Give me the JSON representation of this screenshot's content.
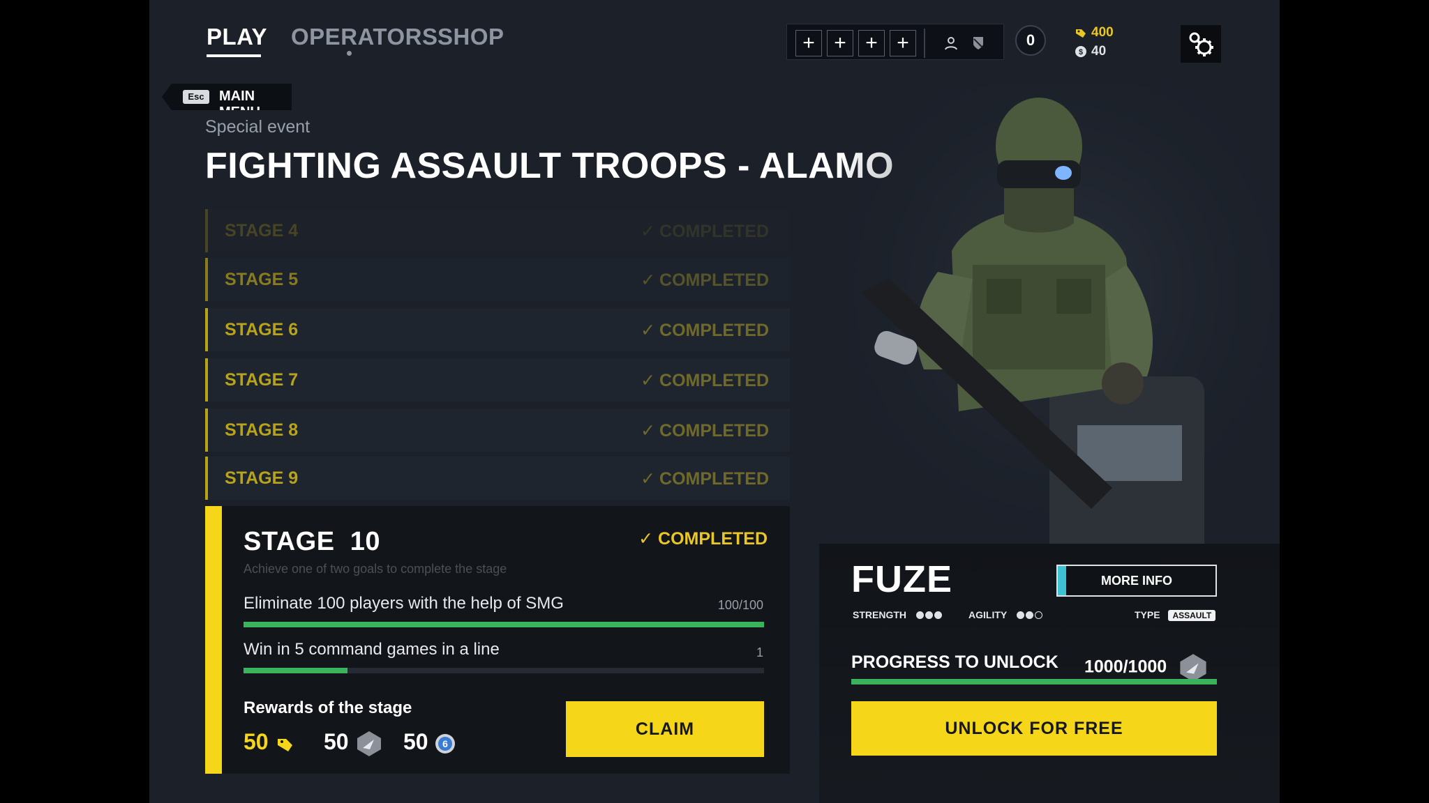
{
  "nav": {
    "tabs": [
      {
        "label": "PLAY",
        "active": true
      },
      {
        "label": "OPERATORS",
        "active": false
      },
      {
        "label": "SHOP",
        "active": false
      }
    ]
  },
  "topbar": {
    "squad_slots": [
      "+",
      "+",
      "+",
      "+"
    ],
    "level_badge": "0",
    "currency_primary": "400",
    "currency_secondary": "40"
  },
  "breadcrumb": {
    "key": "Esc",
    "label": "MAIN MENU"
  },
  "event": {
    "subtitle": "Special event",
    "title": "FIGHTING ASSAULT TROOPS - ALAMO"
  },
  "stages": [
    {
      "name": "STAGE 4",
      "status": "COMPLETED"
    },
    {
      "name": "STAGE 5",
      "status": "COMPLETED"
    },
    {
      "name": "STAGE 6",
      "status": "COMPLETED"
    },
    {
      "name": "STAGE 7",
      "status": "COMPLETED"
    },
    {
      "name": "STAGE 8",
      "status": "COMPLETED"
    },
    {
      "name": "STAGE 9",
      "status": "COMPLETED"
    }
  ],
  "active_stage": {
    "title": "STAGE  10",
    "status": "COMPLETED",
    "description": "Achieve one of two goals to complete the stage",
    "goals": [
      {
        "text": "Eliminate 100 players with the help of SMG",
        "value": "100/100",
        "progress": 1.0
      },
      {
        "text": "Win in 5 command games in a line",
        "value": "1",
        "progress": 0.2
      }
    ],
    "rewards_label": "Rewards of the stage",
    "rewards": [
      {
        "amount": "50",
        "icon": "dogtag-icon"
      },
      {
        "amount": "50",
        "icon": "operator-token-icon"
      },
      {
        "amount": "50",
        "icon": "xp-coin-icon"
      }
    ],
    "claim_label": "CLAIM"
  },
  "operator": {
    "name": "FUZE",
    "more_info_label": "MORE INFO",
    "strength_label": "STRENGTH",
    "strength": 3,
    "agility_label": "AGILITY",
    "agility": 2,
    "type_label": "TYPE",
    "type": "ASSAULT",
    "progress_label": "PROGRESS TO UNLOCK",
    "progress_value": "1000/1000",
    "progress": 1.0,
    "unlock_label": "UNLOCK FOR FREE"
  },
  "colors": {
    "accent_yellow": "#f5d619",
    "progress_green": "#3bb25c",
    "info_cyan": "#3ec1d0"
  }
}
